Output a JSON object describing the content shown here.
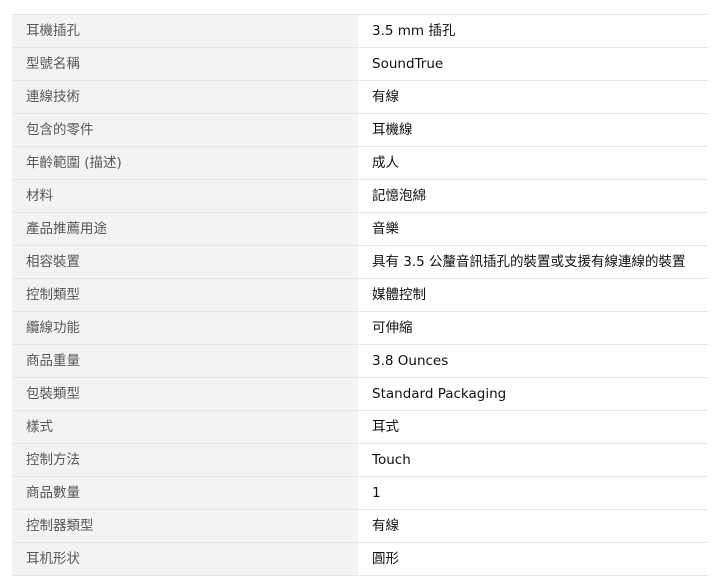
{
  "spec_table": {
    "rows": [
      {
        "label": "耳機插孔",
        "value": "3.5 mm 插孔"
      },
      {
        "label": "型號名稱",
        "value": "SoundTrue"
      },
      {
        "label": "連線技術",
        "value": "有線"
      },
      {
        "label": "包含的零件",
        "value": "耳機線"
      },
      {
        "label": "年齡範圍 (描述)",
        "value": "成人"
      },
      {
        "label": "材料",
        "value": "記憶泡綿"
      },
      {
        "label": "產品推薦用途",
        "value": "音樂"
      },
      {
        "label": "相容裝置",
        "value": "具有 3.5 公釐音訊插孔的裝置或支援有線連線的裝置"
      },
      {
        "label": "控制類型",
        "value": "媒體控制"
      },
      {
        "label": "纜線功能",
        "value": "可伸縮"
      },
      {
        "label": "商品重量",
        "value": "3.8 Ounces"
      },
      {
        "label": "包裝類型",
        "value": "Standard Packaging"
      },
      {
        "label": "樣式",
        "value": "耳式"
      },
      {
        "label": "控制方法",
        "value": "Touch"
      },
      {
        "label": "商品數量",
        "value": "1"
      },
      {
        "label": "控制器類型",
        "value": "有線"
      },
      {
        "label": "耳机形状",
        "value": "圓形"
      }
    ]
  }
}
